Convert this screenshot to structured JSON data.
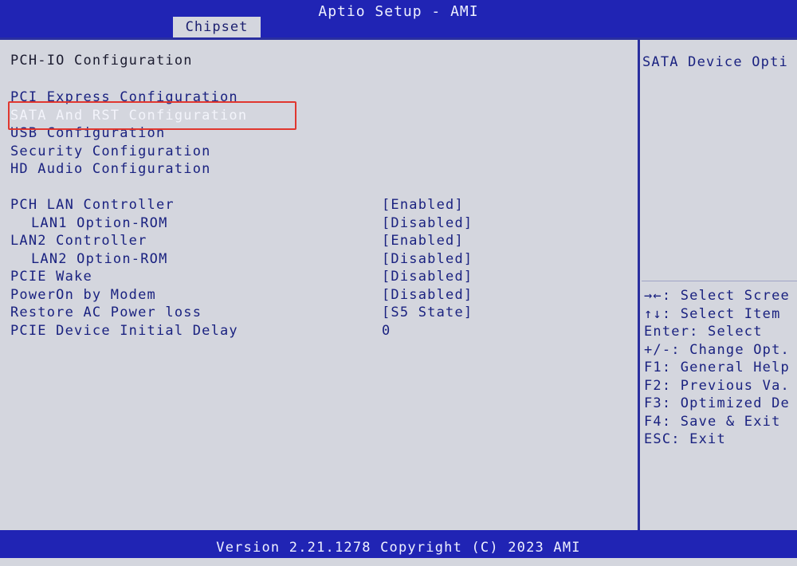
{
  "app": {
    "title": "Aptio Setup - AMI"
  },
  "tabs": [
    {
      "label": "Chipset"
    }
  ],
  "main": {
    "heading": "PCH-IO Configuration",
    "submenus": [
      {
        "label": "PCI Express Configuration"
      },
      {
        "label": "SATA And RST Configuration"
      },
      {
        "label": "USB Configuration"
      },
      {
        "label": "Security Configuration"
      },
      {
        "label": "HD Audio Configuration"
      }
    ],
    "settings": [
      {
        "label": "PCH LAN Controller",
        "value": "[Enabled]"
      },
      {
        "label": "LAN1 Option-ROM",
        "value": "[Disabled]"
      },
      {
        "label": "LAN2 Controller",
        "value": "[Enabled]"
      },
      {
        "label": "LAN2 Option-ROM",
        "value": "[Disabled]"
      },
      {
        "label": "PCIE Wake",
        "value": "[Disabled]"
      },
      {
        "label": "PowerOn by Modem",
        "value": "[Disabled]"
      },
      {
        "label": "Restore AC Power loss",
        "value": "[S5 State]"
      },
      {
        "label": "PCIE Device Initial Delay",
        "value": "0"
      }
    ]
  },
  "help": {
    "text": "SATA Device Opti"
  },
  "keys": [
    {
      "text": "→←: Select Scree"
    },
    {
      "text": "↑↓: Select Item"
    },
    {
      "text": "Enter: Select"
    },
    {
      "text": "+/-: Change Opt."
    },
    {
      "text": "F1: General Help"
    },
    {
      "text": "F2: Previous Va."
    },
    {
      "text": "F3: Optimized De"
    },
    {
      "text": "F4: Save & Exit"
    },
    {
      "text": "ESC: Exit"
    }
  ],
  "footer": {
    "text": "Version 2.21.1278 Copyright (C) 2023 AMI"
  },
  "colors": {
    "header_blue": "#2024b4",
    "panel_bg": "#d4d6de",
    "text_blue": "#1a2280",
    "selection_outline": "#e0372f"
  }
}
